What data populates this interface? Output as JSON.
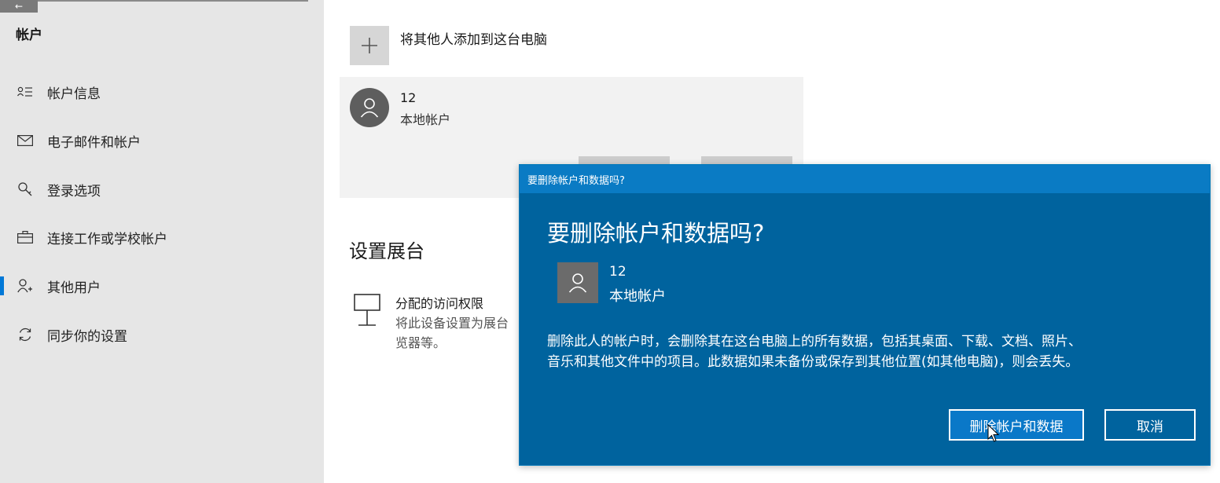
{
  "sidebar": {
    "back_glyph": "←",
    "heading": "帐户",
    "items": [
      {
        "icon": "account-info-icon",
        "label": "帐户信息"
      },
      {
        "icon": "mail-icon",
        "label": "电子邮件和帐户"
      },
      {
        "icon": "key-icon",
        "label": "登录选项"
      },
      {
        "icon": "briefcase-icon",
        "label": "连接工作或学校帐户"
      },
      {
        "icon": "person-add-icon",
        "label": "其他用户",
        "selected": true
      },
      {
        "icon": "sync-icon",
        "label": "同步你的设置"
      }
    ]
  },
  "main": {
    "add_label": "将其他人添加到这台电脑",
    "user": {
      "name": "12",
      "type": "本地帐户"
    },
    "kiosk_section": {
      "title": "设置展台",
      "item_title": "分配的访问权限",
      "item_desc_line1": "将此设备设置为展台",
      "item_desc_line2": "览器等。"
    }
  },
  "dialog": {
    "titlebar": "要删除帐户和数据吗?",
    "heading": "要删除帐户和数据吗?",
    "user": {
      "name": "12",
      "type": "本地帐户"
    },
    "message_line1": "删除此人的帐户时，会删除其在这台电脑上的所有数据，包括其桌面、下载、文档、照片、",
    "message_line2": "音乐和其他文件中的项目。此数据如果未备份或保存到其他位置(如其他电脑)，则会丢失。",
    "delete_button": "删除帐户和数据",
    "cancel_button": "取消"
  },
  "colors": {
    "accent": "#0078d7",
    "dialog_bg": "#00639e",
    "dialog_titlebar": "#0a7bc4",
    "sidebar_bg": "#e6e6e6"
  }
}
